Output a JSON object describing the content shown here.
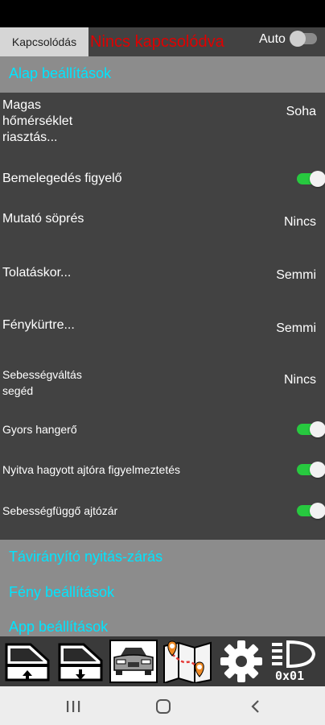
{
  "header": {
    "connect_button": "Kapcsolódás",
    "connection_status": "Nincs kapcsolódva",
    "auto_label": "Auto",
    "auto_enabled": false
  },
  "sections": {
    "basic": "Alap beállítások",
    "remote": "Távirányító nyitás-zárás",
    "light": "Fény beállítások",
    "app": "App beállítások"
  },
  "settings": {
    "high_temp": {
      "label_lines": [
        "Magas",
        "hőmérséklet",
        "riasztás..."
      ],
      "value": "Soha"
    },
    "warmup": {
      "label": "Bemelegedés figyelő",
      "enabled": true
    },
    "gauge_sweep": {
      "label": "Mutató söprés",
      "value": "Nincs"
    },
    "reverse": {
      "label": "Tolatáskor...",
      "value": "Semmi"
    },
    "headlight": {
      "label": "Fénykürtre...",
      "value": "Semmi"
    },
    "shift_assist": {
      "label_lines": [
        "Sebességváltás",
        "segéd"
      ],
      "value": "Nincs"
    },
    "quick_volume": {
      "label": "Gyors hangerő",
      "enabled": true
    },
    "door_warning": {
      "label": "Nyitva hagyott ajtóra figyelmeztetés",
      "enabled": true
    },
    "speed_lock": {
      "label": "Sebességfüggő ajtózár",
      "enabled": true
    }
  },
  "toolbar": {
    "light_code": "0x01",
    "icons": [
      "window-up-icon",
      "window-down-icon",
      "car-front-icon",
      "map-icon",
      "gear-icon",
      "headlight-icon"
    ]
  },
  "colors": {
    "accent": "#00e5ff",
    "status_error": "#e00000",
    "toggle_on": "#27c93f",
    "panel": "#424242",
    "section": "#8c8c8c"
  }
}
